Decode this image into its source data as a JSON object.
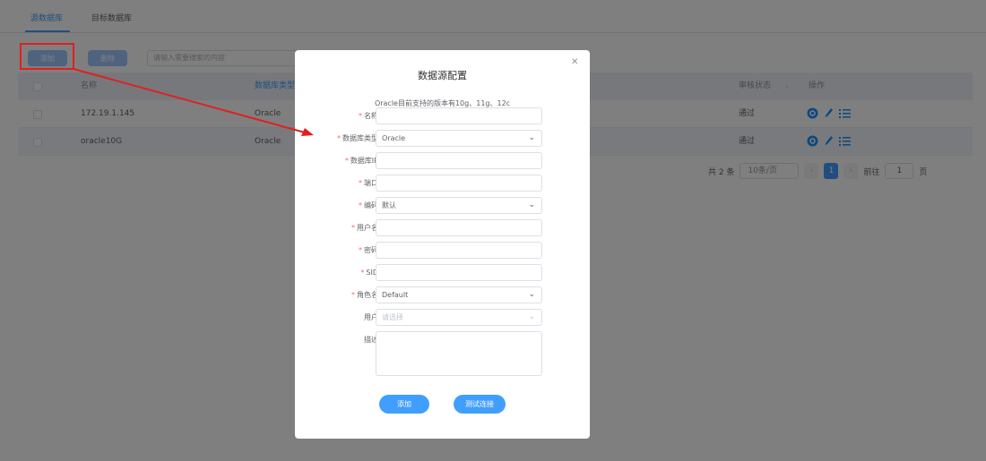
{
  "tabs": [
    {
      "label": "源数据库"
    },
    {
      "label": "目标数据库"
    }
  ],
  "toolbar": {
    "add_label": "添加",
    "delete_label": "删除",
    "search_placeholder": "请输入需要搜索的内容"
  },
  "table": {
    "headers": {
      "name": "名称",
      "db_type": "数据库类型",
      "audit_status": "审核状态",
      "actions": "操作"
    },
    "rows": [
      {
        "name": "172.19.1.145",
        "db_type": "Oracle",
        "audit_status": "通过"
      },
      {
        "name": "oracle10G",
        "db_type": "Oracle",
        "audit_status": "通过"
      }
    ]
  },
  "pagination": {
    "total": "共 2 条",
    "page_size": "10条/页",
    "current_page": "1",
    "goto_label": "前往",
    "goto_value": "1",
    "page_suffix": "页"
  },
  "dialog": {
    "title": "数据源配置",
    "note": "Oracle目前支持的版本有10g、11g、12c",
    "fields": {
      "name": {
        "label": "名称",
        "value": ""
      },
      "db_type": {
        "label": "数据库类型",
        "value": "Oracle"
      },
      "db_ip": {
        "label": "数据库IP",
        "value": ""
      },
      "port": {
        "label": "端口",
        "value": ""
      },
      "encoding": {
        "label": "编码",
        "value": "默认"
      },
      "username": {
        "label": "用户名",
        "value": ""
      },
      "password": {
        "label": "密码",
        "value": ""
      },
      "sid": {
        "label": "SID",
        "value": ""
      },
      "role": {
        "label": "角色名",
        "value": "Default"
      },
      "user": {
        "label": "用户",
        "placeholder": "请选择"
      },
      "description": {
        "label": "描述",
        "value": ""
      }
    },
    "add_button": "添加",
    "test_button": "测试连接"
  },
  "colors": {
    "primary": "#409eff",
    "annotation": "#e02020"
  }
}
